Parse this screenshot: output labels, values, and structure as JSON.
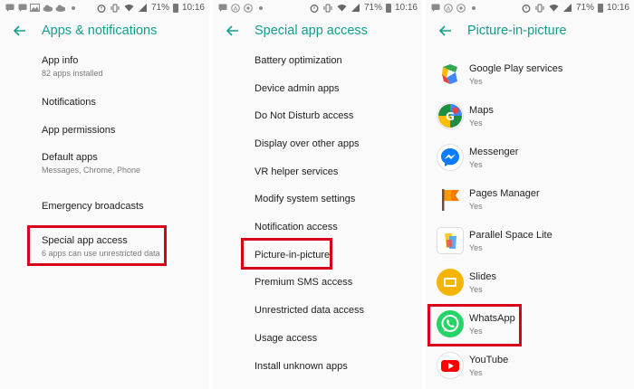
{
  "status_bar": {
    "battery": "71%",
    "time": "10:16",
    "network": "4G"
  },
  "panel1": {
    "title": "Apps & notifications",
    "items": [
      {
        "title": "App info",
        "subtitle": "82 apps installed"
      },
      {
        "title": "Notifications",
        "subtitle": ""
      },
      {
        "title": "App permissions",
        "subtitle": ""
      },
      {
        "title": "Default apps",
        "subtitle": "Messages, Chrome, Phone"
      },
      {
        "title": "Emergency broadcasts",
        "subtitle": ""
      },
      {
        "title": "Special app access",
        "subtitle": "6 apps can use unrestricted data"
      }
    ]
  },
  "panel2": {
    "title": "Special app access",
    "items": [
      "Battery optimization",
      "Device admin apps",
      "Do Not Disturb access",
      "Display over other apps",
      "VR helper services",
      "Modify system settings",
      "Notification access",
      "Picture-in-picture",
      "Premium SMS access",
      "Unrestricted data access",
      "Usage access",
      "Install unknown apps"
    ]
  },
  "panel3": {
    "title": "Picture-in-picture",
    "apps": [
      {
        "name": "Google Play services",
        "status": "Yes",
        "icon": "google-play-services-icon"
      },
      {
        "name": "Maps",
        "status": "Yes",
        "icon": "maps-icon"
      },
      {
        "name": "Messenger",
        "status": "Yes",
        "icon": "messenger-icon"
      },
      {
        "name": "Pages Manager",
        "status": "Yes",
        "icon": "pages-manager-icon"
      },
      {
        "name": "Parallel Space Lite",
        "status": "Yes",
        "icon": "parallel-space-icon"
      },
      {
        "name": "Slides",
        "status": "Yes",
        "icon": "slides-icon"
      },
      {
        "name": "WhatsApp",
        "status": "Yes",
        "icon": "whatsapp-icon"
      },
      {
        "name": "YouTube",
        "status": "Yes",
        "icon": "youtube-icon"
      }
    ]
  },
  "colors": {
    "accent": "#129e8e",
    "highlight": "#d9001b"
  }
}
